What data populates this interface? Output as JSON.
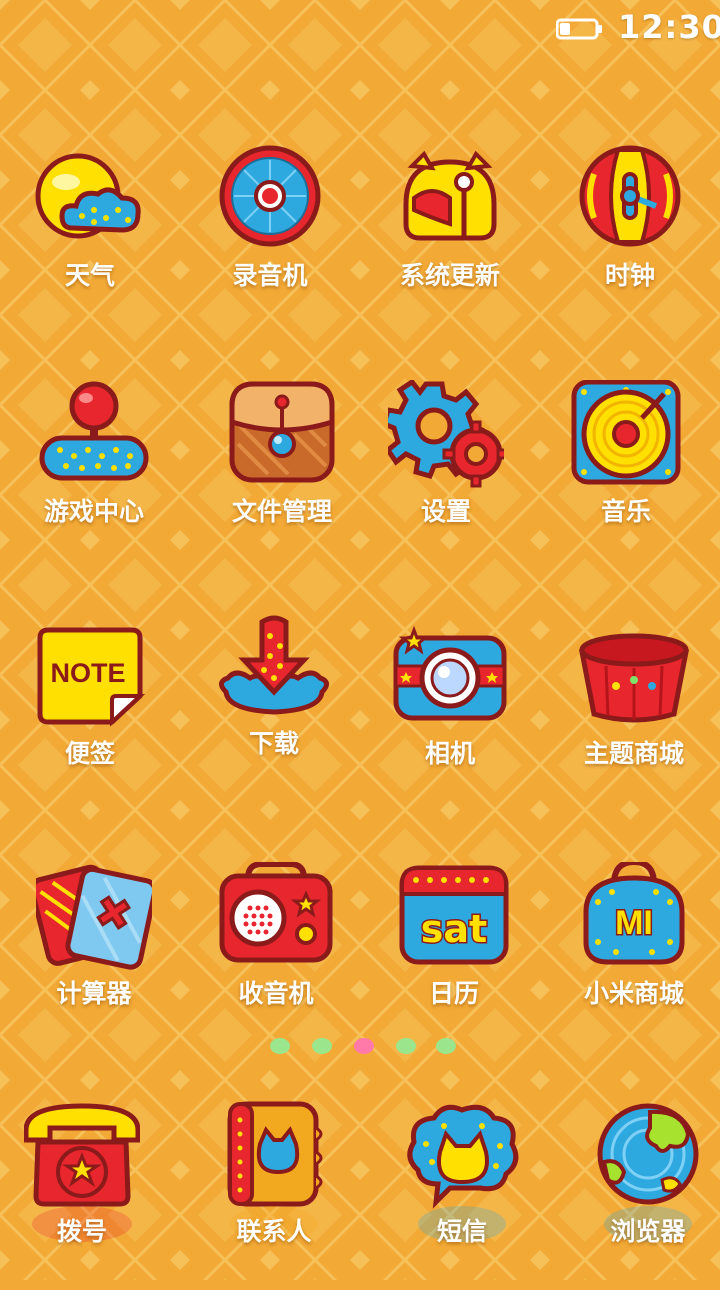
{
  "status_bar": {
    "time": "12:30",
    "battery_icon": "battery-icon",
    "battery_level": 0.25
  },
  "colors": {
    "background": "#f2a935",
    "outline": "#8b1a1a",
    "red": "#e8262d",
    "blue": "#2da9e0",
    "yellow": "#ffe000",
    "white": "#ffffff"
  },
  "apps": [
    {
      "label": "天气",
      "icon": "weather-icon"
    },
    {
      "label": "录音机",
      "icon": "recorder-icon"
    },
    {
      "label": "系统更新",
      "icon": "system-update-icon"
    },
    {
      "label": "时钟",
      "icon": "clock-icon"
    },
    {
      "label": "游戏中心",
      "icon": "joystick-icon"
    },
    {
      "label": "文件管理",
      "icon": "folder-bag-icon"
    },
    {
      "label": "设置",
      "icon": "gear-icon"
    },
    {
      "label": "音乐",
      "icon": "vinyl-record-icon"
    },
    {
      "label": "便签",
      "icon": "note-icon",
      "icon_text": "NOTE"
    },
    {
      "label": "下载",
      "icon": "download-arrow-icon"
    },
    {
      "label": "相机",
      "icon": "camera-icon"
    },
    {
      "label": "主题商城",
      "icon": "theme-store-icon"
    },
    {
      "label": "计算器",
      "icon": "calculator-cards-icon"
    },
    {
      "label": "收音机",
      "icon": "radio-icon"
    },
    {
      "label": "日历",
      "icon": "calendar-icon",
      "icon_text": "sat"
    },
    {
      "label": "小米商城",
      "icon": "mi-bag-icon",
      "icon_text": "MI"
    }
  ],
  "page_indicator": {
    "count": 5,
    "active_index": 2,
    "dot_colors": [
      "#9be68c",
      "#9be68c",
      "#ff7aa8",
      "#9be68c",
      "#9be68c"
    ]
  },
  "dock": [
    {
      "label": "拨号",
      "icon": "telephone-icon"
    },
    {
      "label": "联系人",
      "icon": "contacts-book-icon"
    },
    {
      "label": "短信",
      "icon": "message-bubble-icon"
    },
    {
      "label": "浏览器",
      "icon": "globe-icon"
    }
  ]
}
